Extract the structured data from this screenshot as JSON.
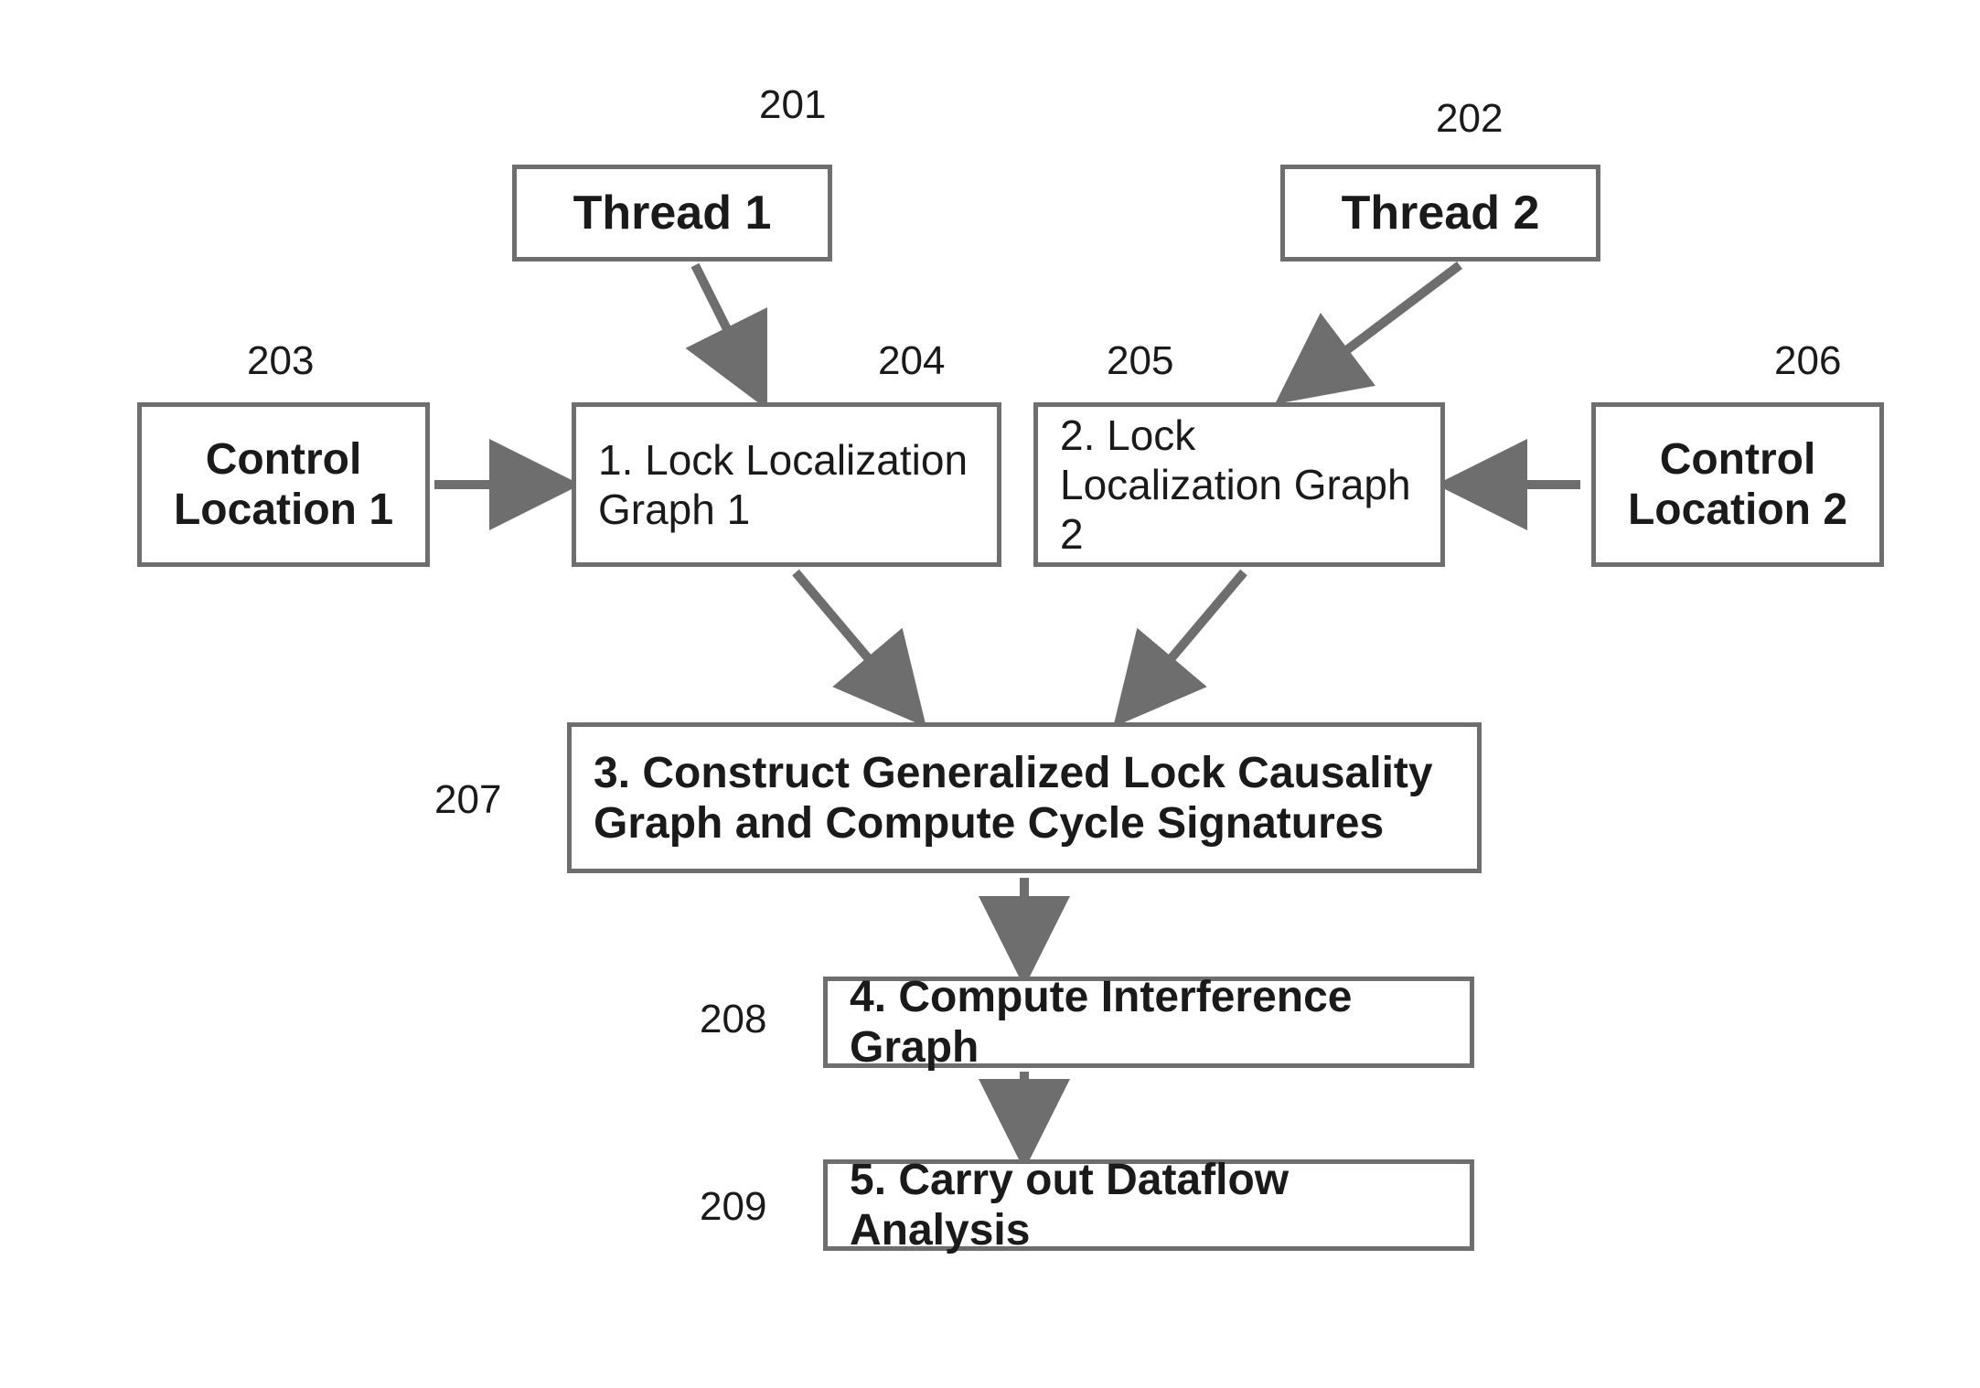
{
  "refs": {
    "r201": "201",
    "r202": "202",
    "r203": "203",
    "r204": "204",
    "r205": "205",
    "r206": "206",
    "r207": "207",
    "r208": "208",
    "r209": "209"
  },
  "boxes": {
    "thread1": "Thread 1",
    "thread2": "Thread 2",
    "control1": "Control Location 1",
    "control2": "Control Location 2",
    "llg1": "1. Lock Localization Graph 1",
    "llg2": "2. Lock Localization Graph 2",
    "step3": "3. Construct Generalized Lock Causality Graph and Compute Cycle Signatures",
    "step4": "4. Compute Interference Graph",
    "step5": "5. Carry out Dataflow Analysis"
  }
}
